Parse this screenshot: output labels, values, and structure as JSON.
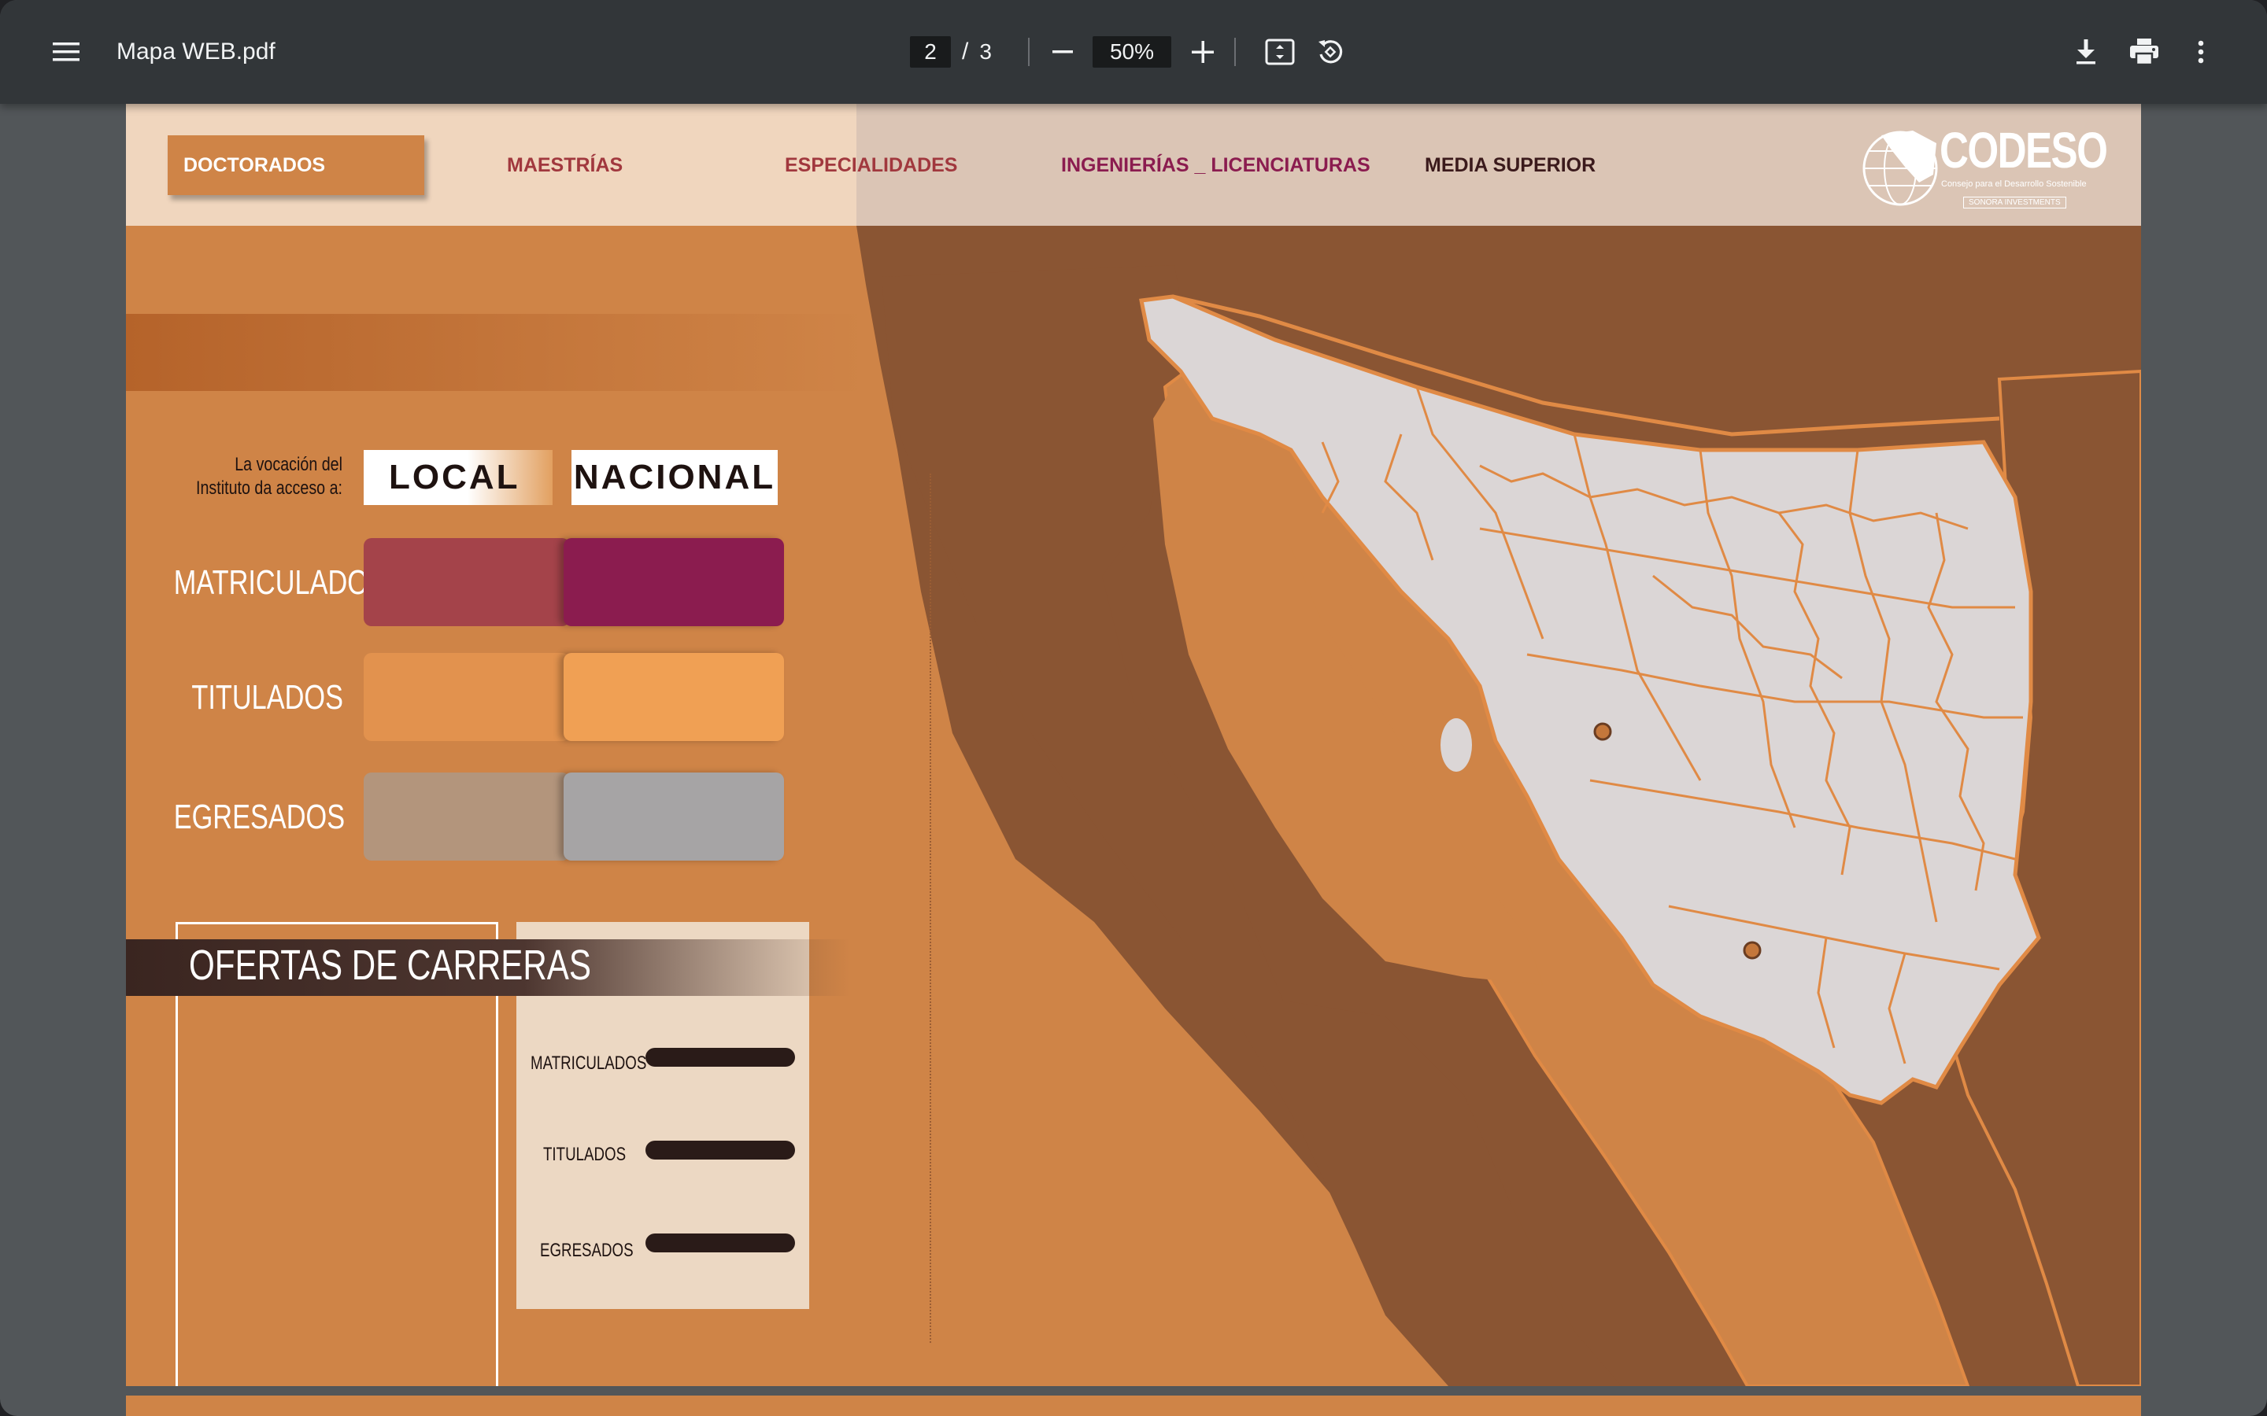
{
  "toolbar": {
    "menu_icon": "hamburger-menu-icon",
    "file_title": "Mapa WEB.pdf",
    "current_page": "2",
    "page_separator": "/",
    "total_pages": "3",
    "zoom_level": "50%",
    "icons": [
      "zoom-out-icon",
      "zoom-in-icon",
      "fit-page-icon",
      "rotate-icon",
      "download-icon",
      "print-icon",
      "more-options-icon"
    ]
  },
  "document": {
    "tabs": {
      "active": "DOCTORADOS",
      "items": [
        {
          "label": "MAESTRÍAS",
          "color": "#a1383e"
        },
        {
          "label": "ESPECIALIDADES",
          "color": "#a1383e"
        },
        {
          "label": "INGENIERÍAS _ LICENCIATURAS",
          "color": "#8b1c4f"
        },
        {
          "label": "MEDIA SUPERIOR",
          "color": "#3b1a1c"
        }
      ]
    },
    "brand": {
      "name": "CODESO",
      "subtitle": "Consejo para el Desarrollo Sostenible",
      "tagline": "SONORA INVESTMENTS"
    },
    "legend": {
      "intro": "La vocación del Instituto da acceso a:",
      "local": "LOCAL",
      "nacional": "NACIONAL",
      "rows": [
        {
          "label": "MATRICULADOS",
          "local_color": "#a4434a",
          "national_color": "#8b1c4f"
        },
        {
          "label": "TITULADOS",
          "local_color": "#e2924e",
          "national_color": "#f0a054"
        },
        {
          "label": "EGRESADOS",
          "local_color": "#b3957c",
          "national_color": "#a6a4a5"
        }
      ]
    },
    "ofertas": {
      "title": "OFERTAS DE CARRERAS",
      "stats": [
        "MATRICULADOS",
        "TITULADOS",
        "EGRESADOS"
      ]
    },
    "map_colors": {
      "land": "#8a5533",
      "sea": "#cf8447",
      "sonora": "#dbd6d6",
      "border": "#e08a45",
      "marker": "#c4773b"
    }
  }
}
